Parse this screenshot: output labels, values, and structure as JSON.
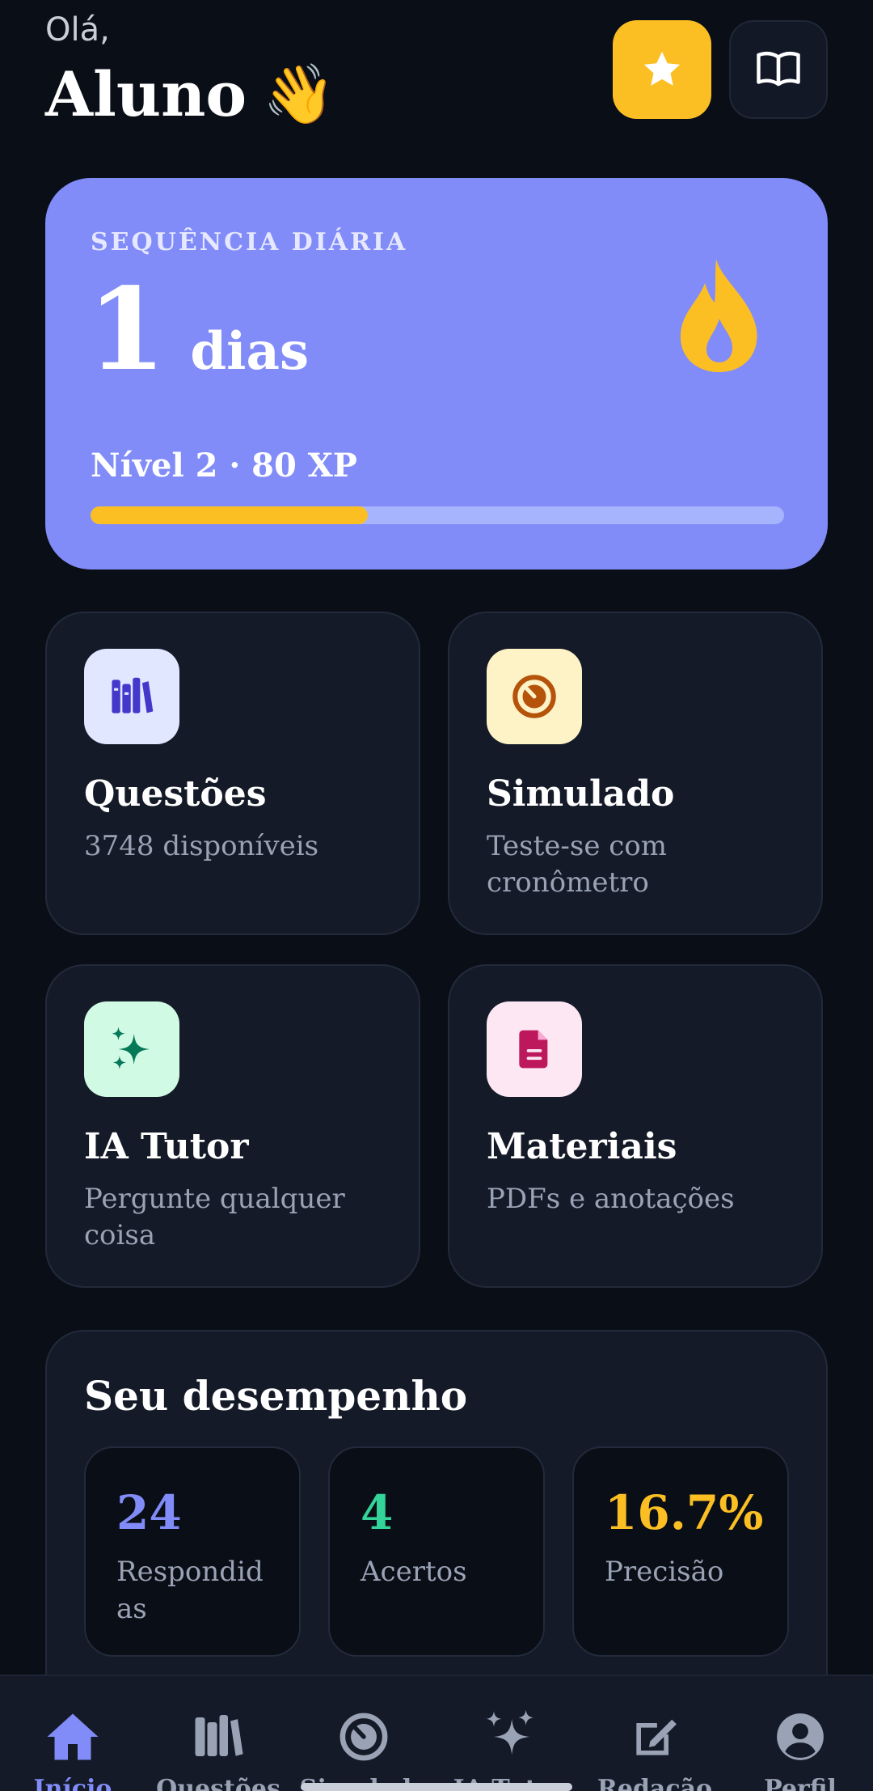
{
  "header": {
    "greeting": "Olá,",
    "name": "Aluno",
    "wave": "👋",
    "star_button_icon": "star-icon",
    "book_button_icon": "book-open-icon"
  },
  "streak": {
    "label": "SEQUÊNCIA DIÁRIA",
    "count": "1",
    "unit": "dias",
    "level_text": "Nível 2 · 80 XP",
    "progress": 0.4,
    "icon": "flame-icon"
  },
  "tiles": [
    {
      "title": "Questões",
      "subtitle": "3748 disponíveis",
      "icon": "books-icon",
      "icon_bg": "#e0e7ff",
      "icon_color": "#4338ca"
    },
    {
      "title": "Simulado",
      "subtitle": "Teste-se com cronômetro",
      "icon": "timer-icon",
      "icon_bg": "#fef3c7",
      "icon_color": "#b45309"
    },
    {
      "title": "IA Tutor",
      "subtitle": "Pergunte qualquer coisa",
      "icon": "sparkles-icon",
      "icon_bg": "#d1fae5",
      "icon_color": "#047857"
    },
    {
      "title": "Materiais",
      "subtitle": "PDFs e anotações",
      "icon": "document-icon",
      "icon_bg": "#fce7f3",
      "icon_color": "#be185d"
    }
  ],
  "performance": {
    "title": "Seu desempenho",
    "stats": [
      {
        "value": "24",
        "label": "Respondidas",
        "color": "#818cf8"
      },
      {
        "value": "4",
        "label": "Acertos",
        "color": "#34d399"
      },
      {
        "value": "16.7%",
        "label": "Precisão",
        "color": "#fbbf24"
      }
    ]
  },
  "nav": {
    "active": "Início",
    "items": [
      {
        "label": "Início",
        "icon": "home-icon"
      },
      {
        "label": "Questões",
        "icon": "books-icon"
      },
      {
        "label": "Simulado",
        "icon": "timer-icon"
      },
      {
        "label": "IA Tutor",
        "icon": "sparkles-icon"
      },
      {
        "label": "Redação",
        "icon": "edit-icon"
      },
      {
        "label": "Perfil",
        "icon": "profile-icon"
      }
    ]
  },
  "colors": {
    "background": "#0a0e17",
    "card": "#141a27",
    "accent": "#818cf8",
    "yellow": "#fbbf24"
  }
}
